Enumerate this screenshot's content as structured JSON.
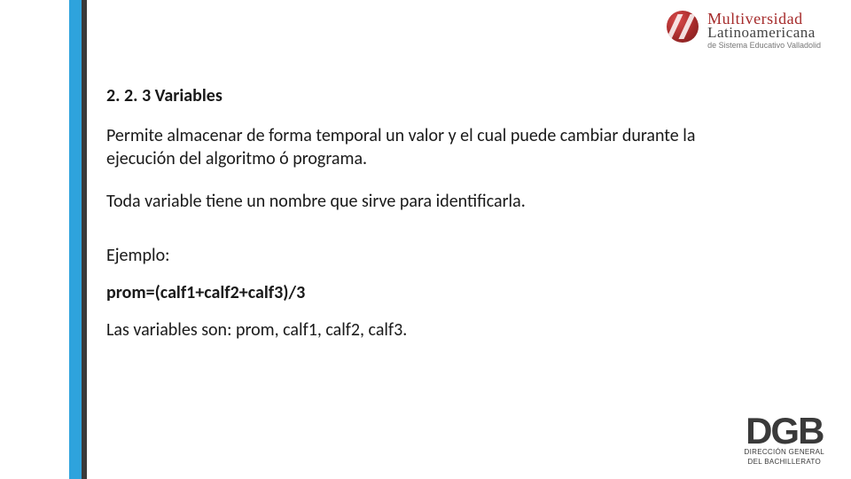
{
  "logo_top": {
    "line1": "Multiversidad",
    "line2": "Latinoamericana",
    "line3": "de Sistema Educativo Valladolid"
  },
  "content": {
    "heading": "2. 2. 3 Variables",
    "p1": "Permite almacenar de forma temporal un valor y el cual puede cambiar durante la ejecución del algoritmo ó programa.",
    "p2": "Toda variable tiene un nombre que sirve para identificarla.",
    "example_label": "Ejemplo:",
    "formula": "prom=(calf1+calf2+calf3)/3",
    "vars": "Las variables son: prom, calf1, calf2, calf3."
  },
  "logo_bottom": {
    "title": "DGB",
    "sub1": "DIRECCIÓN GENERAL",
    "sub2": "DEL BACHILLERATO"
  }
}
